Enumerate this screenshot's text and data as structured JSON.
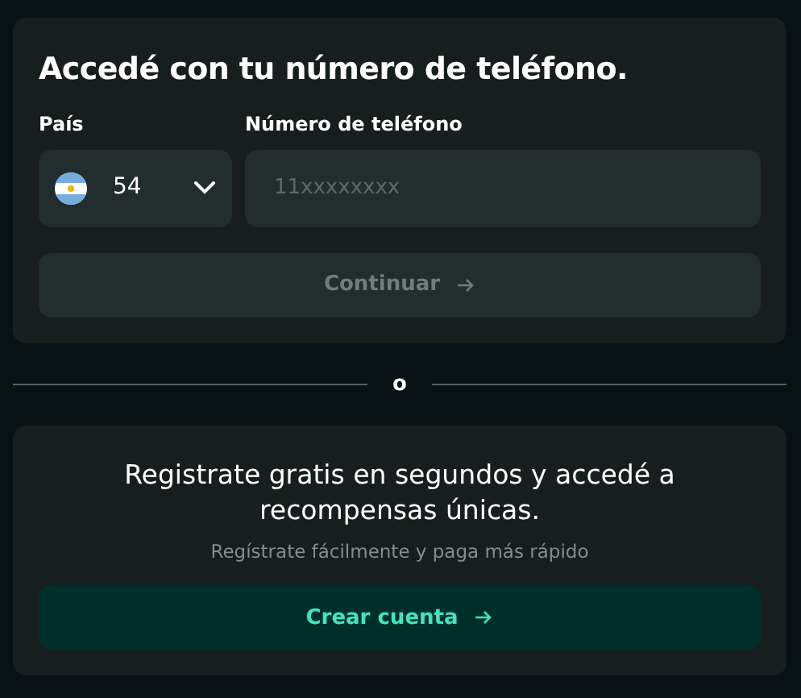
{
  "login_card": {
    "title": "Accedé con tu número de teléfono.",
    "country_label": "País",
    "country_code": "54",
    "phone_label": "Número de teléfono",
    "phone_placeholder": "11xxxxxxxx",
    "continue_button": {
      "label": "Continuar",
      "disabled": true
    }
  },
  "divider_text": "o",
  "signup_card": {
    "heading": "Registrate gratis en segundos y accedé a recompensas únicas.",
    "subtext": "Regístrate fácilmente y paga más rápido",
    "create_button": {
      "label": "Crear cuenta",
      "disabled": false
    }
  }
}
